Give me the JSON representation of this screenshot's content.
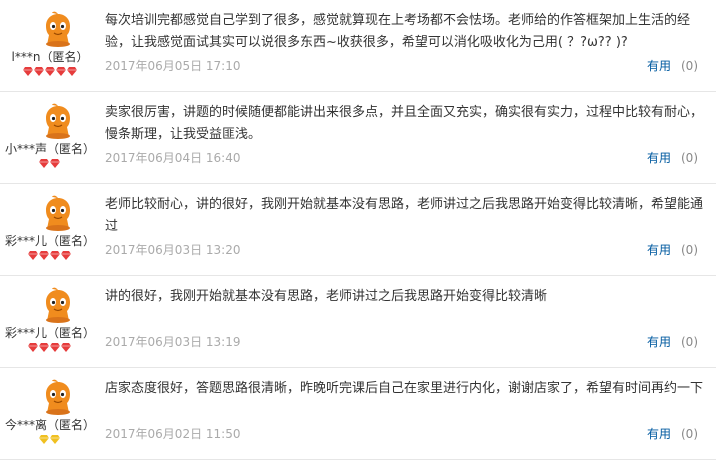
{
  "colors": {
    "accent_link": "#005aa0",
    "date_text": "#aaaaaa",
    "avatar_orange": "#f08c1e",
    "badge_red": "#e63c3c",
    "badge_gold": "#f0c020"
  },
  "icons": {
    "avatar": "avatar-icon",
    "badge": "diamond-badge-icon"
  },
  "reviews": [
    {
      "username": "l***n（匿名）",
      "badge_color": "red",
      "badge_count": 5,
      "text": "每次培训完都感觉自己学到了很多，感觉就算现在上考场都不会怯场。老师给的作答框架加上生活的经验，让我感觉面试其实可以说很多东西~收获很多，希望可以消化吸收化为己用( ？?ω?? )?",
      "date": "2017年06月05日 17:10",
      "useful_label": "有用",
      "useful_count": "(0)"
    },
    {
      "username": "小***声（匿名）",
      "badge_color": "red",
      "badge_count": 2,
      "text": "卖家很厉害，讲题的时候随便都能讲出来很多点，并且全面又充实，确实很有实力，过程中比较有耐心，慢条斯理，让我受益匪浅。",
      "date": "2017年06月04日 16:40",
      "useful_label": "有用",
      "useful_count": "(0)"
    },
    {
      "username": "彩***儿（匿名）",
      "badge_color": "red",
      "badge_count": 4,
      "text": "老师比较耐心，讲的很好，我刚开始就基本没有思路，老师讲过之后我思路开始变得比较清晰，希望能通过",
      "date": "2017年06月03日 13:20",
      "useful_label": "有用",
      "useful_count": "(0)"
    },
    {
      "username": "彩***儿（匿名）",
      "badge_color": "red",
      "badge_count": 4,
      "text": "讲的很好，我刚开始就基本没有思路，老师讲过之后我思路开始变得比较清晰",
      "date": "2017年06月03日 13:19",
      "useful_label": "有用",
      "useful_count": "(0)"
    },
    {
      "username": "今***离（匿名）",
      "badge_color": "gold",
      "badge_count": 2,
      "text": "店家态度很好，答题思路很清晰，昨晚听完课后自己在家里进行内化，谢谢店家了，希望有时间再约一下",
      "date": "2017年06月02日 11:50",
      "useful_label": "有用",
      "useful_count": "(0)"
    }
  ]
}
